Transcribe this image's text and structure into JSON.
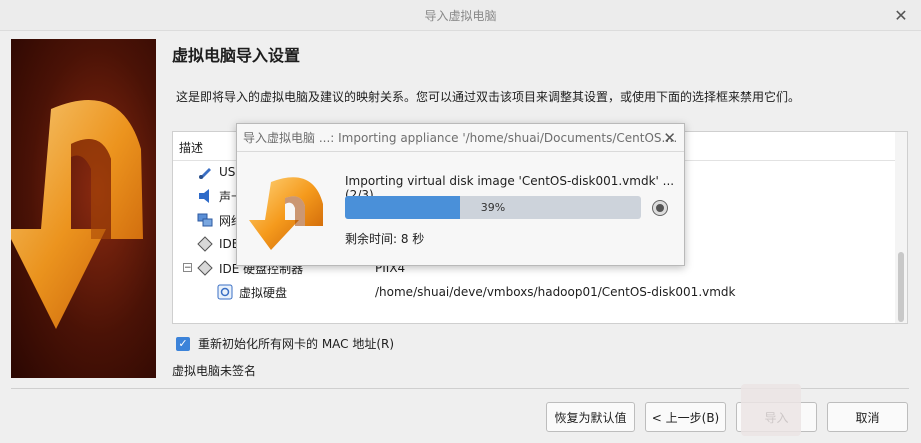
{
  "window": {
    "title": "导入虚拟电脑"
  },
  "page": {
    "heading": "虚拟电脑导入设置",
    "description": "这是即将导入的虚拟电脑及建议的映射关系。您可以通过双击该项目来调整其设置，或使用下面的选择框来禁用它们。"
  },
  "tree": {
    "header": "描述",
    "rows": [
      {
        "label": "USB",
        "value": ""
      },
      {
        "label": "声卡",
        "value": ""
      },
      {
        "label": "网络",
        "value": ""
      },
      {
        "label": "IDE",
        "value": ""
      },
      {
        "label": "IDE 硬盘控制器",
        "value": "PIIX4"
      },
      {
        "label": "虚拟硬盘",
        "value": "/home/shuai/deve/vmboxs/hadoop01/CentOS-disk001.vmdk"
      }
    ]
  },
  "options": {
    "reinit_mac_label": "重新初始化所有网卡的 MAC 地址(R)",
    "reinit_mac_checked": true,
    "unsigned_text": "虚拟电脑未签名"
  },
  "buttons": {
    "restore_defaults": "恢复为默认值",
    "back": "< 上一步(B)",
    "import": "导入",
    "cancel": "取消"
  },
  "progress": {
    "title": "导入虚拟电脑 ...: Importing appliance '/home/shuai/Documents/CentOS.…",
    "message": "Importing virtual disk image 'CentOS-disk001.vmdk' ... (2/3)",
    "percent": 39,
    "percent_label": "39%",
    "time_remaining": "剩余时间:   8 秒"
  }
}
